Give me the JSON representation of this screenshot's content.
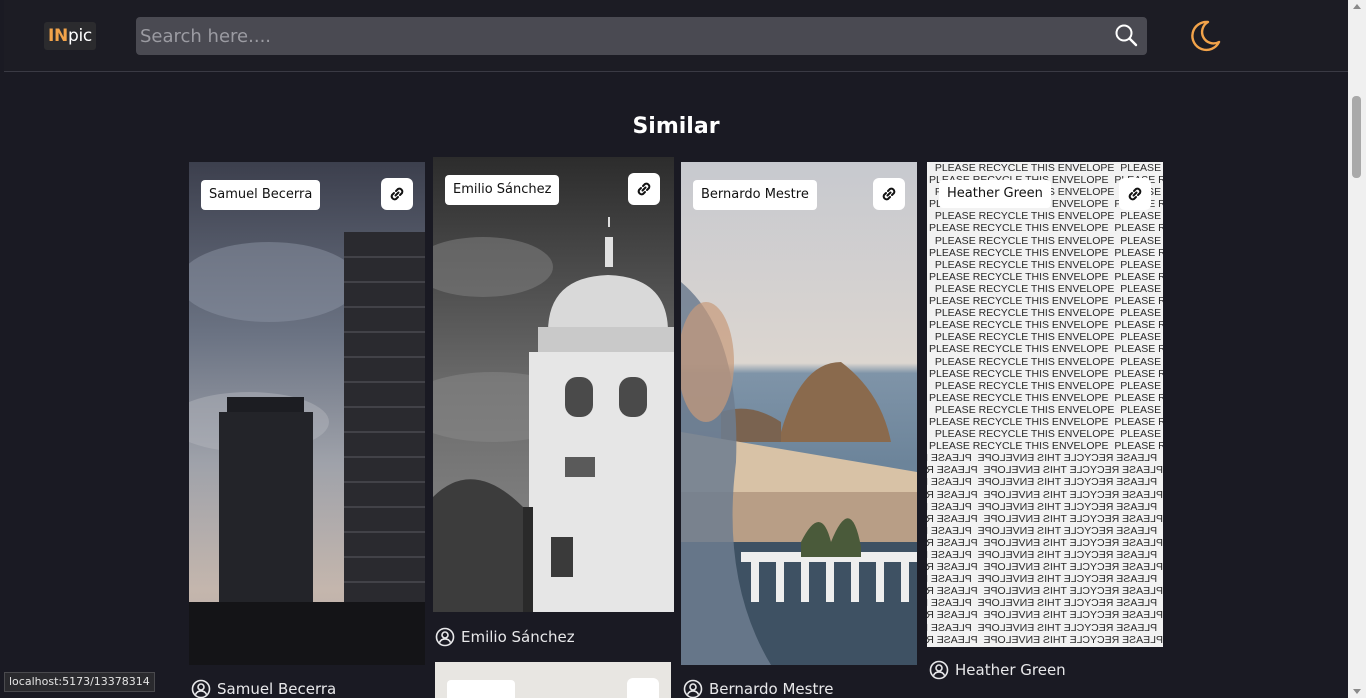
{
  "header": {
    "logo_part1": "IN",
    "logo_part2": "pic",
    "search_placeholder": "Search here....",
    "search_icon": "search-icon",
    "theme_icon": "moon-icon"
  },
  "section_title": "Similar",
  "cards": [
    {
      "tag": "Samuel Becerra",
      "author": "Samuel Becerra",
      "link_icon": "link-icon",
      "user_icon": "user-circle-icon"
    },
    {
      "tag": "Emilio Sánchez",
      "author": "Emilio Sánchez",
      "link_icon": "link-icon",
      "user_icon": "user-circle-icon"
    },
    {
      "tag": "Bernardo Mestre",
      "author": "Bernardo Mestre",
      "link_icon": "link-icon",
      "user_icon": "user-circle-icon"
    },
    {
      "tag": "Heather Green",
      "author": "Heather Green",
      "link_icon": "link-icon",
      "user_icon": "user-circle-icon",
      "photo_text": "PLEASE RECYCLE THIS ENVELOPE"
    }
  ],
  "status_url": "localhost:5173/13378314",
  "colors": {
    "background": "#1a1a23",
    "accent": "#f2a34a",
    "search_bg": "#4a4a52"
  }
}
